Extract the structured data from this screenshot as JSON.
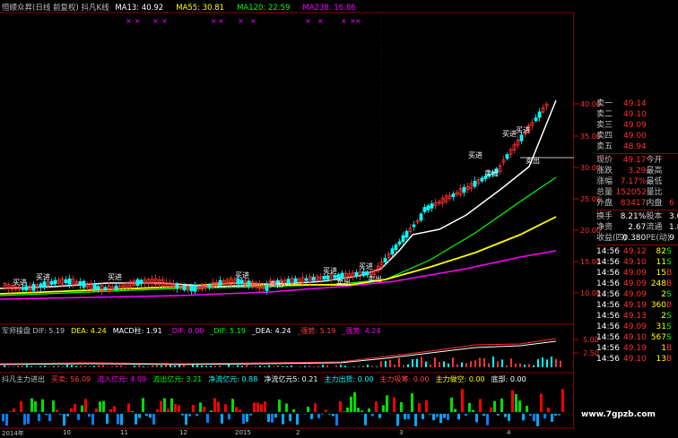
{
  "header": {
    "title": "恒顺众昇(日线 前复权) 抖凡K线",
    "ma_items": [
      {
        "label": "MA13: 40.92",
        "color": "#ffffff"
      },
      {
        "label": "MA55: 30.81",
        "color": "#ffff00"
      },
      {
        "label": "MA120: 22.59",
        "color": "#00ff00"
      },
      {
        "label": "MA238: 16.86",
        "color": "#ff00ff"
      }
    ]
  },
  "price_axis": [
    "40.00",
    "35.00",
    "30.00",
    "25.00",
    "20.00",
    "15.00",
    "10.00"
  ],
  "macd_axis": [
    "5.00",
    "2.50"
  ],
  "markers": {
    "buy": "买进",
    "sell": "卖出",
    "watch": "观望"
  },
  "macd_header": [
    {
      "label": "军师操盘 DIF: 5.19",
      "color": "#c0c0c0"
    },
    {
      "label": "DEA: 4.24",
      "color": "#ffff00"
    },
    {
      "label": "MACD柱: 1.91",
      "color": "#ffffff"
    },
    {
      "label": "_DIF: 0.00",
      "color": "#ff00ff"
    },
    {
      "label": "_DIF: 5.19",
      "color": "#00ff00"
    },
    {
      "label": "_DEA: 4.24",
      "color": "#ffffff"
    },
    {
      "label": "_强势: 5.19",
      "color": "#ff4040"
    },
    {
      "label": "_强势: 4.24",
      "color": "#ff00ff"
    }
  ],
  "flow_header": [
    {
      "label": "抖凡主力进出",
      "color": "#c0c0c0"
    },
    {
      "label": "买卖: 56.09",
      "color": "#ff4040"
    },
    {
      "label": "流入亿元: 4.09",
      "color": "#ff00ff"
    },
    {
      "label": "流出亿元: 3.21",
      "color": "#00ff00"
    },
    {
      "label": "净流亿元: 0.88",
      "color": "#00ffff"
    },
    {
      "label": "净流亿元5: 0.21",
      "color": "#ffffff"
    },
    {
      "label": "主力出货: 0.00",
      "color": "#00ffff"
    },
    {
      "label": "主力吸筹: 0.00",
      "color": "#ff4040"
    },
    {
      "label": "主力做空: 0.00",
      "color": "#ffff00"
    },
    {
      "label": "底部: 0.00",
      "color": "#ffffff"
    }
  ],
  "date_axis": [
    "2014年",
    "10",
    "11",
    "12",
    "2015",
    "2",
    "3",
    "4"
  ],
  "order_book": {
    "sell": [
      {
        "label": "卖一",
        "price": "49.14"
      },
      {
        "label": "卖二",
        "price": "49.10"
      },
      {
        "label": "卖三",
        "price": "49.09"
      },
      {
        "label": "卖四",
        "price": "49.00"
      },
      {
        "label": "卖五",
        "price": "48.94"
      }
    ]
  },
  "quote": [
    {
      "l1": "现价",
      "v1": "49.17",
      "l2": "今开",
      "v2": ""
    },
    {
      "l1": "涨跌",
      "v1": "3.29",
      "l2": "最高",
      "v2": ""
    },
    {
      "l1": "涨幅",
      "v1": "7.17%",
      "l2": "最低",
      "v2": ""
    },
    {
      "l1": "总量",
      "v1": "152052",
      "l2": "量比",
      "v2": ""
    },
    {
      "l1": "外盘",
      "v1": "83417",
      "l2": "内盘",
      "v2": "6"
    }
  ],
  "stats": [
    {
      "l1": "换手",
      "v1": "8.21%",
      "l2": "股本",
      "v2": "3.0"
    },
    {
      "l1": "净资",
      "v1": "2.67",
      "l2": "流通",
      "v2": "1.8"
    },
    {
      "l1": "收益(四)",
      "v1": "0.380",
      "l2": "PE(动)",
      "v2": "9"
    }
  ],
  "ticks": [
    {
      "time": "14:56",
      "price": "49.12",
      "vol": "82",
      "side": "S"
    },
    {
      "time": "14:56",
      "price": "49.10",
      "vol": "11",
      "side": "S"
    },
    {
      "time": "14:56",
      "price": "49.09",
      "vol": "15",
      "side": "B"
    },
    {
      "time": "14:56",
      "price": "49.09",
      "vol": "248",
      "side": "B"
    },
    {
      "time": "14:56",
      "price": "49.09",
      "vol": "2",
      "side": "S"
    },
    {
      "time": "14:56",
      "price": "49.19",
      "vol": "360",
      "side": "B"
    },
    {
      "time": "14:56",
      "price": "49.13",
      "vol": "2",
      "side": "S"
    },
    {
      "time": "14:56",
      "price": "49.09",
      "vol": "31",
      "side": "S"
    },
    {
      "time": "14:56",
      "price": "49.10",
      "vol": "567",
      "side": "S"
    },
    {
      "time": "14:56",
      "price": "49.19",
      "vol": "1",
      "side": "B"
    },
    {
      "time": "14:56",
      "price": "49.10",
      "vol": "13",
      "side": "B"
    }
  ],
  "watermark": "www.7gpzb.com",
  "colors": {
    "up": "#ff3030",
    "down": "#00ffff",
    "grid": "#8b0000",
    "text": "#c0c0c0"
  }
}
